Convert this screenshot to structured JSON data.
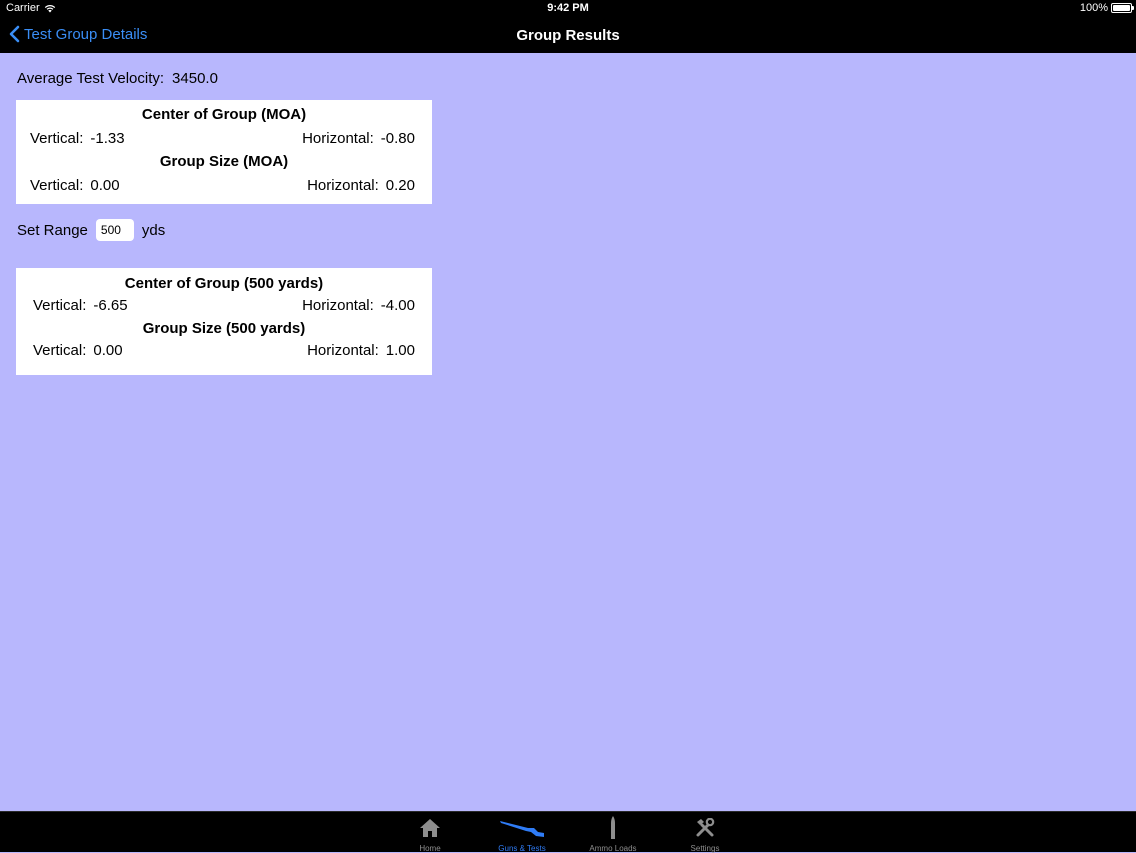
{
  "status_bar": {
    "carrier": "Carrier",
    "time": "9:42 PM",
    "battery": "100%"
  },
  "nav": {
    "back_label": "Test Group Details",
    "title": "Group Results"
  },
  "average": {
    "label": "Average Test Velocity:",
    "value": "3450.0"
  },
  "moa_card": {
    "center_heading": "Center of Group (MOA)",
    "center_vertical_label": "Vertical:",
    "center_vertical_value": "-1.33",
    "center_horizontal_label": "Horizontal:",
    "center_horizontal_value": "-0.80",
    "size_heading": "Group Size (MOA)",
    "size_vertical_label": "Vertical:",
    "size_vertical_value": "0.00",
    "size_horizontal_label": "Horizontal:",
    "size_horizontal_value": "0.20"
  },
  "range": {
    "label": "Set Range",
    "value": "500",
    "unit": "yds"
  },
  "yards_card": {
    "center_heading": "Center of Group  (500 yards)",
    "center_vertical_label": "Vertical:",
    "center_vertical_value": "-6.65",
    "center_horizontal_label": "Horizontal:",
    "center_horizontal_value": "-4.00",
    "size_heading": "Group Size  (500 yards)",
    "size_vertical_label": "Vertical:",
    "size_vertical_value": "0.00",
    "size_horizontal_label": "Horizontal:",
    "size_horizontal_value": "1.00"
  },
  "tabs": [
    {
      "label": "Home",
      "icon": "home-icon",
      "active": false
    },
    {
      "label": "Guns & Tests",
      "icon": "rifle-icon",
      "active": true
    },
    {
      "label": "Ammo Loads",
      "icon": "bullet-icon",
      "active": false
    },
    {
      "label": "Settings",
      "icon": "tools-icon",
      "active": false
    }
  ],
  "colors": {
    "background": "#b8b7fd",
    "accent": "#2f7cf6",
    "bar": "#000000"
  }
}
